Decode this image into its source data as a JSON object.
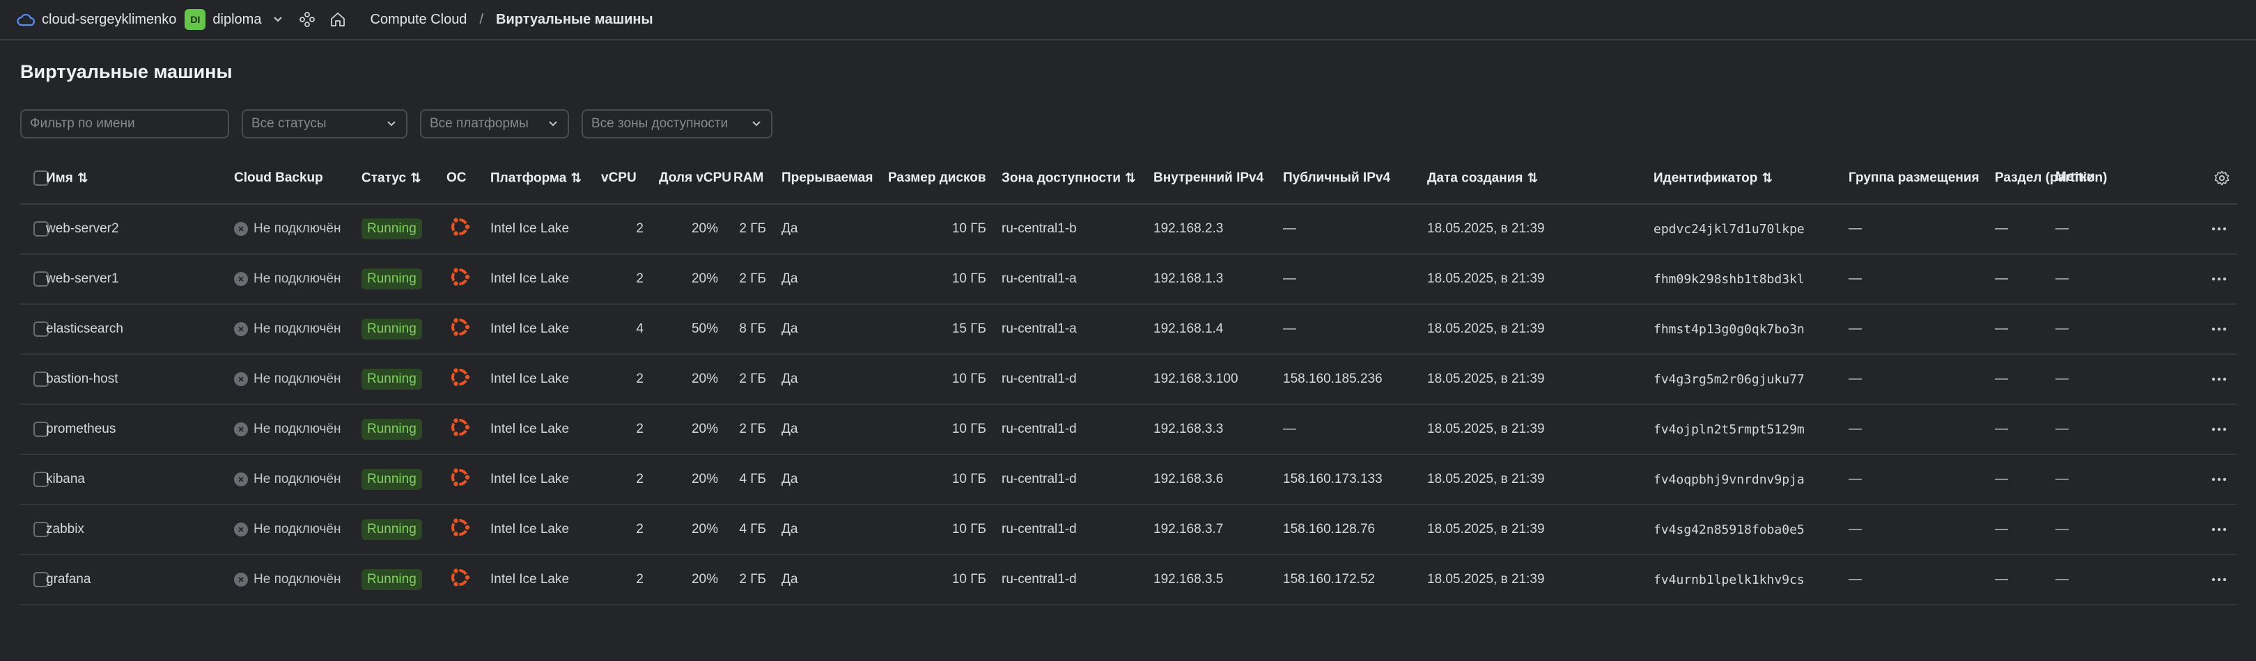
{
  "header": {
    "org": "cloud-sergeyklimenko",
    "folder_badge": "DI",
    "folder": "diploma",
    "breadcrumb_service": "Compute Cloud",
    "breadcrumb_sep": "/",
    "breadcrumb_page": "Виртуальные машины"
  },
  "page": {
    "title": "Виртуальные машины"
  },
  "filters": {
    "name_placeholder": "Фильтр по имени",
    "status": "Все статусы",
    "platform": "Все платформы",
    "zone": "Все зоны доступности"
  },
  "columns": {
    "name": "Имя",
    "backup": "Cloud Backup",
    "status": "Статус",
    "os": "ОС",
    "platform": "Платформа",
    "vcpu": "vCPU",
    "vcpu_share": "Доля vCPU",
    "ram": "RAM",
    "preemptible": "Прерываемая",
    "disk_size": "Размер дисков",
    "zone": "Зона доступности",
    "internal_ip": "Внутренний IPv4",
    "public_ip": "Публичный IPv4",
    "created": "Дата создания",
    "id": "Идентификатор",
    "placement_group": "Группа размещения",
    "partition": "Раздел (partition)",
    "labels": "Метки"
  },
  "rows": [
    {
      "name": "web-server2",
      "backup": "Не подключён",
      "status": "Running",
      "platform": "Intel Ice Lake",
      "vcpu": "2",
      "share": "20%",
      "ram": "2 ГБ",
      "preemptible": "Да",
      "disk": "10 ГБ",
      "zone": "ru-central1-b",
      "internal_ip": "192.168.2.3",
      "public_ip": "—",
      "created": "18.05.2025, в 21:39",
      "id": "epdvc24jkl7d1u70lkpe",
      "placement": "—",
      "partition": "—",
      "labels": "—"
    },
    {
      "name": "web-server1",
      "backup": "Не подключён",
      "status": "Running",
      "platform": "Intel Ice Lake",
      "vcpu": "2",
      "share": "20%",
      "ram": "2 ГБ",
      "preemptible": "Да",
      "disk": "10 ГБ",
      "zone": "ru-central1-a",
      "internal_ip": "192.168.1.3",
      "public_ip": "—",
      "created": "18.05.2025, в 21:39",
      "id": "fhm09k298shb1t8bd3kl",
      "placement": "—",
      "partition": "—",
      "labels": "—"
    },
    {
      "name": "elasticsearch",
      "backup": "Не подключён",
      "status": "Running",
      "platform": "Intel Ice Lake",
      "vcpu": "4",
      "share": "50%",
      "ram": "8 ГБ",
      "preemptible": "Да",
      "disk": "15 ГБ",
      "zone": "ru-central1-a",
      "internal_ip": "192.168.1.4",
      "public_ip": "—",
      "created": "18.05.2025, в 21:39",
      "id": "fhmst4p13g0g0qk7bo3n",
      "placement": "—",
      "partition": "—",
      "labels": "—"
    },
    {
      "name": "bastion-host",
      "backup": "Не подключён",
      "status": "Running",
      "platform": "Intel Ice Lake",
      "vcpu": "2",
      "share": "20%",
      "ram": "2 ГБ",
      "preemptible": "Да",
      "disk": "10 ГБ",
      "zone": "ru-central1-d",
      "internal_ip": "192.168.3.100",
      "public_ip": "158.160.185.236",
      "created": "18.05.2025, в 21:39",
      "id": "fv4g3rg5m2r06gjuku77",
      "placement": "—",
      "partition": "—",
      "labels": "—"
    },
    {
      "name": "prometheus",
      "backup": "Не подключён",
      "status": "Running",
      "platform": "Intel Ice Lake",
      "vcpu": "2",
      "share": "20%",
      "ram": "2 ГБ",
      "preemptible": "Да",
      "disk": "10 ГБ",
      "zone": "ru-central1-d",
      "internal_ip": "192.168.3.3",
      "public_ip": "—",
      "created": "18.05.2025, в 21:39",
      "id": "fv4ojpln2t5rmpt5129m",
      "placement": "—",
      "partition": "—",
      "labels": "—"
    },
    {
      "name": "kibana",
      "backup": "Не подключён",
      "status": "Running",
      "platform": "Intel Ice Lake",
      "vcpu": "2",
      "share": "20%",
      "ram": "4 ГБ",
      "preemptible": "Да",
      "disk": "10 ГБ",
      "zone": "ru-central1-d",
      "internal_ip": "192.168.3.6",
      "public_ip": "158.160.173.133",
      "created": "18.05.2025, в 21:39",
      "id": "fv4oqpbhj9vnrdnv9pja",
      "placement": "—",
      "partition": "—",
      "labels": "—"
    },
    {
      "name": "zabbix",
      "backup": "Не подключён",
      "status": "Running",
      "platform": "Intel Ice Lake",
      "vcpu": "2",
      "share": "20%",
      "ram": "4 ГБ",
      "preemptible": "Да",
      "disk": "10 ГБ",
      "zone": "ru-central1-d",
      "internal_ip": "192.168.3.7",
      "public_ip": "158.160.128.76",
      "created": "18.05.2025, в 21:39",
      "id": "fv4sg42n85918foba0e5",
      "placement": "—",
      "partition": "—",
      "labels": "—"
    },
    {
      "name": "grafana",
      "backup": "Не подключён",
      "status": "Running",
      "platform": "Intel Ice Lake",
      "vcpu": "2",
      "share": "20%",
      "ram": "2 ГБ",
      "preemptible": "Да",
      "disk": "10 ГБ",
      "zone": "ru-central1-d",
      "internal_ip": "192.168.3.5",
      "public_ip": "158.160.172.52",
      "created": "18.05.2025, в 21:39",
      "id": "fv4urnb1lpelk1khv9cs",
      "placement": "—",
      "partition": "—",
      "labels": "—"
    }
  ],
  "icons": {
    "cloud": "cloud-icon",
    "chevron": "chevron-down-icon",
    "services": "services-icon",
    "home": "home-icon",
    "os": "ubuntu-icon",
    "more": "more-icon",
    "settings": "gear-icon"
  },
  "colors": {
    "background": "#232529",
    "status_running_bg": "#2b4a23",
    "status_running_text": "#7fd15f",
    "ubuntu": "#e95420",
    "folder_badge": "#66c64a"
  }
}
